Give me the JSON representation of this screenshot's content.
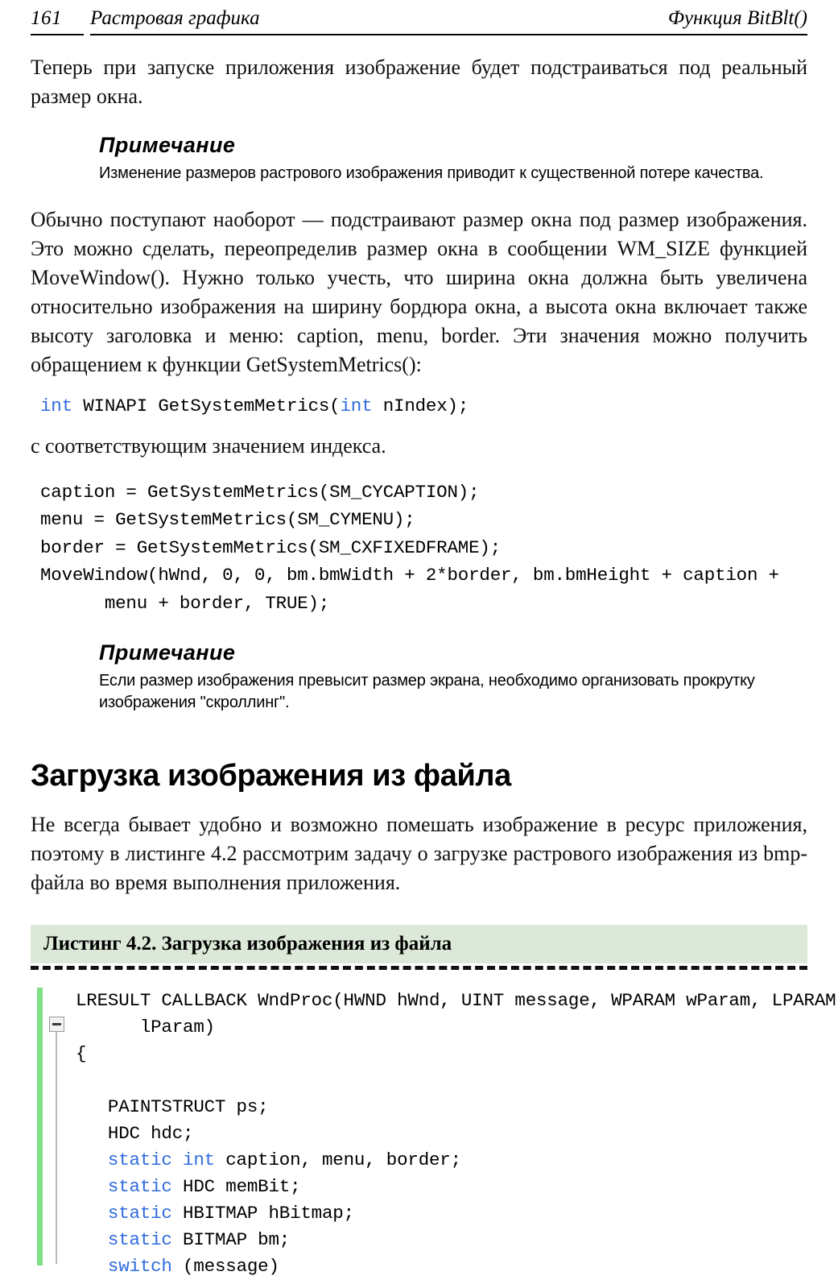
{
  "header": {
    "page_number": "161",
    "section_title": "Растровая графика",
    "right_title": "Функция BitBlt()"
  },
  "intro_paragraph": "Теперь при запуске приложения изображение будет подстраиваться под реальный размер окна.",
  "note1": {
    "title": "Примечание",
    "body": "Изменение размеров растрового изображения приводит к существенной потере качества."
  },
  "paragraph2": "Обычно поступают наоборот — подстраивают размер окна под размер изображения. Это можно сделать, переопределив размер окна в сообщении WM_SIZE функцией MoveWindow(). Нужно только учесть, что ширина окна должна быть увеличена относительно изображения на ширину бордюра окна, а высота окна включает также высоту заголовка и меню: caption, menu, border. Эти значения можно получить обращением к функции GetSystemMetrics():",
  "code_signature": {
    "keyword1": "int",
    "mid": " WINAPI GetSystemMetrics(",
    "keyword2": "int",
    "tail": " nIndex);"
  },
  "paragraph3": "с соответствующим значением индекса.",
  "code_block2": "caption = GetSystemMetrics(SM_CYCAPTION);\nmenu = GetSystemMetrics(SM_CYMENU);\nborder = GetSystemMetrics(SM_CXFIXEDFRAME);\nMoveWindow(hWnd, 0, 0, bm.bmWidth + 2*border, bm.bmHeight + caption +\n      menu + border, TRUE);",
  "note2": {
    "title": "Примечание",
    "body": "Если размер изображения превысит размер экрана, необходимо организовать прокрутку изображения \"скроллинг\"."
  },
  "section_heading": "Загрузка изображения из файла",
  "paragraph4": "Не всегда бывает удобно и возможно помешать изображение в ресурс приложения, поэтому в листинге 4.2 рассмотрим задачу о загрузке растрового изображения из bmp-файла во время выполнения приложения.",
  "listing": {
    "caption": "Листинг 4.2. Загрузка изображения из файла",
    "background_color": "#dde9d8",
    "changebar_color": "#7fe085",
    "keyword_color": "#2f6bdd",
    "fold_icon": "collapse-minus-icon",
    "lines": [
      {
        "indent": 0,
        "segments": [
          {
            "text": "LRESULT CALLBACK WndProc(HWND hWnd, UINT message, WPARAM wParam, LPARAM",
            "kw": false
          }
        ]
      },
      {
        "indent": 0,
        "segments": [
          {
            "text": "      lParam)",
            "kw": false
          }
        ]
      },
      {
        "indent": 0,
        "segments": [
          {
            "text": "{",
            "kw": false
          }
        ]
      },
      {
        "indent": 0,
        "segments": [
          {
            "text": "",
            "kw": false
          }
        ]
      },
      {
        "indent": 0,
        "segments": [
          {
            "text": "   PAINTSTRUCT ps;",
            "kw": false
          }
        ]
      },
      {
        "indent": 0,
        "segments": [
          {
            "text": "   HDC hdc;",
            "kw": false
          }
        ]
      },
      {
        "indent": 0,
        "segments": [
          {
            "text": "   ",
            "kw": false
          },
          {
            "text": "static int",
            "kw": true
          },
          {
            "text": " caption, menu, border;",
            "kw": false
          }
        ]
      },
      {
        "indent": 0,
        "segments": [
          {
            "text": "   ",
            "kw": false
          },
          {
            "text": "static",
            "kw": true
          },
          {
            "text": " HDC memBit;",
            "kw": false
          }
        ]
      },
      {
        "indent": 0,
        "segments": [
          {
            "text": "   ",
            "kw": false
          },
          {
            "text": "static",
            "kw": true
          },
          {
            "text": " HBITMAP hBitmap;",
            "kw": false
          }
        ]
      },
      {
        "indent": 0,
        "segments": [
          {
            "text": "   ",
            "kw": false
          },
          {
            "text": "static",
            "kw": true
          },
          {
            "text": " BITMAP bm;",
            "kw": false
          }
        ]
      },
      {
        "indent": 0,
        "segments": [
          {
            "text": "   ",
            "kw": false
          },
          {
            "text": "switch",
            "kw": true
          },
          {
            "text": " (message)",
            "kw": false
          }
        ]
      }
    ]
  }
}
